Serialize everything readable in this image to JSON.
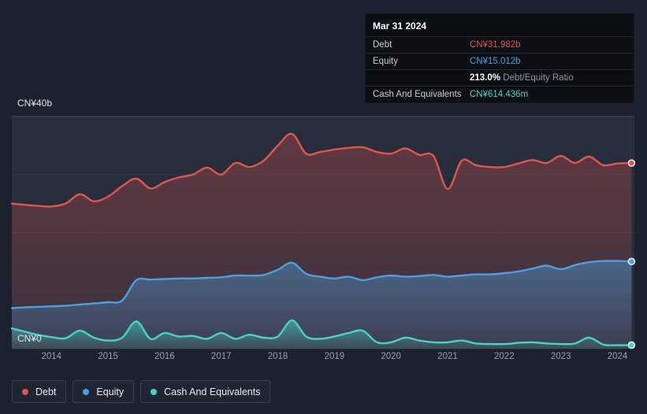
{
  "chart_data": {
    "type": "area",
    "x_range": [
      2013.3,
      2024.3
    ],
    "ylim": [
      0,
      40
    ],
    "y_gridlines": [
      0,
      10,
      20,
      30,
      40
    ],
    "y_top_label": "CN¥40b",
    "y_bottom_label": "CN¥0",
    "x_ticks": [
      2014,
      2015,
      2016,
      2017,
      2018,
      2019,
      2020,
      2021,
      2022,
      2023,
      2024
    ],
    "x": [
      2013.3,
      2013.5,
      2013.75,
      2014,
      2014.25,
      2014.5,
      2014.75,
      2015,
      2015.25,
      2015.5,
      2015.75,
      2016,
      2016.25,
      2016.5,
      2016.75,
      2017,
      2017.25,
      2017.5,
      2017.75,
      2018,
      2018.25,
      2018.5,
      2018.75,
      2019,
      2019.25,
      2019.5,
      2019.75,
      2020,
      2020.25,
      2020.5,
      2020.75,
      2021,
      2021.25,
      2021.5,
      2021.75,
      2022,
      2022.25,
      2022.5,
      2022.75,
      2023,
      2023.25,
      2023.5,
      2023.75,
      2024,
      2024.25
    ],
    "series": [
      {
        "name": "Debt",
        "color": "#e4544d",
        "values": [
          25.0,
          24.8,
          24.6,
          24.5,
          25.0,
          26.6,
          25.4,
          26.2,
          28.0,
          29.3,
          27.6,
          28.7,
          29.5,
          30.0,
          31.2,
          30.0,
          32.0,
          31.3,
          32.4,
          35.0,
          37.0,
          33.6,
          33.9,
          34.3,
          34.6,
          34.7,
          33.9,
          33.6,
          34.5,
          33.4,
          33.2,
          27.5,
          32.4,
          31.6,
          31.3,
          31.3,
          31.9,
          32.5,
          32.0,
          33.2,
          32.0,
          33.1,
          31.6,
          31.9,
          31.982
        ]
      },
      {
        "name": "Equity",
        "color": "#4aa0e0",
        "values": [
          7.0,
          7.1,
          7.2,
          7.3,
          7.4,
          7.6,
          7.8,
          8.0,
          8.3,
          11.8,
          11.9,
          12.0,
          12.1,
          12.1,
          12.2,
          12.3,
          12.6,
          12.6,
          12.7,
          13.6,
          14.8,
          12.9,
          12.4,
          12.1,
          12.4,
          11.8,
          12.3,
          12.6,
          12.4,
          12.5,
          12.7,
          12.4,
          12.6,
          12.8,
          12.8,
          13.0,
          13.3,
          13.8,
          14.3,
          13.7,
          14.4,
          14.9,
          15.1,
          15.1,
          15.012
        ]
      },
      {
        "name": "Cash And Equivalents",
        "color": "#45d5c2",
        "values": [
          3.5,
          3.0,
          2.4,
          2.0,
          1.8,
          3.1,
          1.9,
          1.4,
          1.9,
          4.7,
          1.7,
          2.7,
          2.1,
          2.2,
          1.7,
          2.7,
          1.7,
          2.4,
          1.9,
          2.1,
          4.9,
          2.1,
          1.7,
          2.1,
          2.7,
          3.1,
          1.1,
          1.1,
          1.9,
          1.4,
          1.1,
          1.1,
          1.4,
          0.9,
          0.8,
          0.8,
          1.0,
          1.1,
          0.9,
          0.8,
          0.9,
          1.9,
          0.7,
          0.6,
          0.614
        ]
      }
    ]
  },
  "tooltip": {
    "date": "Mar 31 2024",
    "debt_label": "Debt",
    "debt_value": "CN¥31.982b",
    "equity_label": "Equity",
    "equity_value": "CN¥15.012b",
    "ratio_value": "213.0%",
    "ratio_label": "Debt/Equity Ratio",
    "cash_label": "Cash And Equivalents",
    "cash_value": "CN¥614.436m"
  },
  "legend": [
    {
      "label": "Debt",
      "color": "#e4544d"
    },
    {
      "label": "Equity",
      "color": "#4aa0e0"
    },
    {
      "label": "Cash And Equivalents",
      "color": "#45d5c2"
    }
  ]
}
